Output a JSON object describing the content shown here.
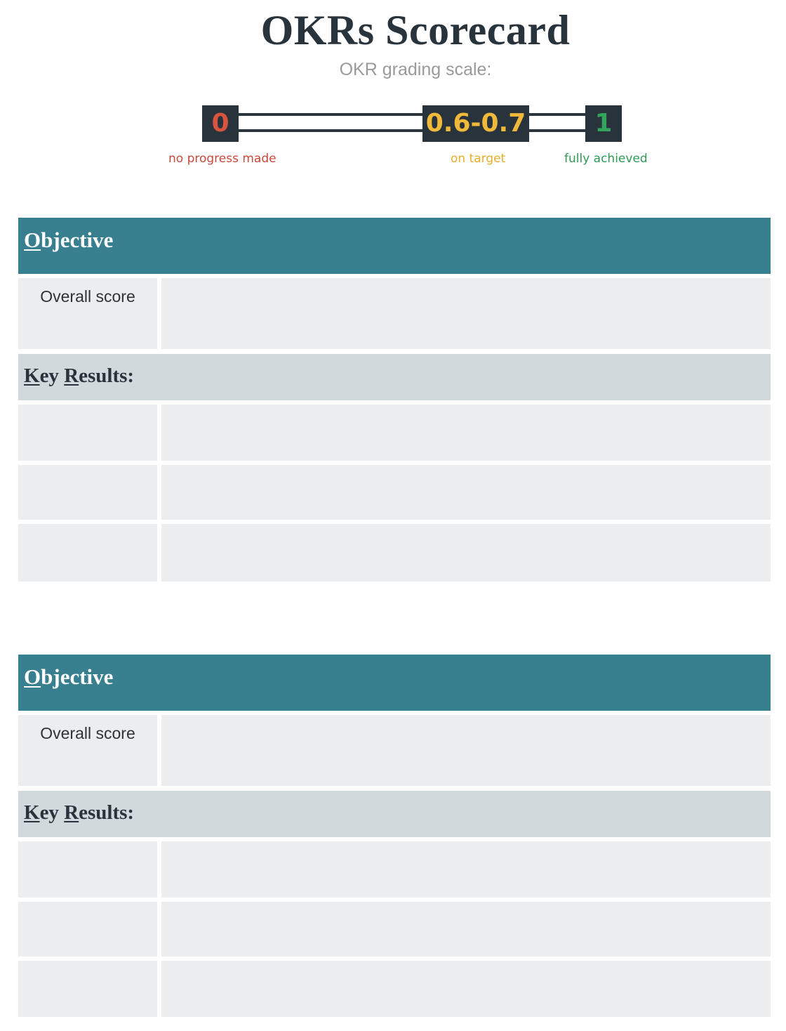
{
  "page": {
    "title": "OKRs Scorecard",
    "subtitle": "OKR grading scale:"
  },
  "scale": {
    "levels": [
      {
        "value": "0",
        "label": "no progress made",
        "color": "#d9543f"
      },
      {
        "value": "0.6-0.7",
        "label": "on target",
        "color": "#f1b93a"
      },
      {
        "value": "1",
        "label": "fully achieved",
        "color": "#34a35c"
      }
    ]
  },
  "cards": [
    {
      "objective": {
        "first": "O",
        "rest": "bjective"
      },
      "overall_label": "Overall score",
      "key_results": {
        "k": "K",
        "ey": "ey ",
        "r": "R",
        "esults": "esults:"
      },
      "rows": 3
    },
    {
      "objective": {
        "first": "O",
        "rest": "bjective"
      },
      "overall_label": "Overall score",
      "key_results": {
        "k": "K",
        "ey": "ey ",
        "r": "R",
        "esults": "esults:"
      },
      "rows": 3
    }
  ],
  "colors": {
    "objective_bar": "#387f8f",
    "key_results_bar": "#d1d9dc",
    "cell": "#ecedef",
    "scale_box": "#28333b"
  }
}
